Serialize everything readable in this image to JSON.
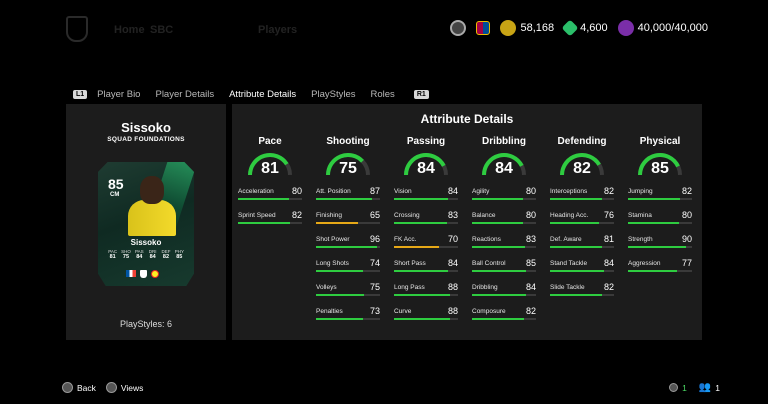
{
  "top": {
    "nav_faded": [
      "Home",
      "SBC",
      "Players"
    ],
    "currencies": [
      {
        "name": "coins",
        "value": "58,168",
        "color": "#c8a415"
      },
      {
        "name": "points",
        "value": "4,600",
        "color": "#2bbf6a"
      },
      {
        "name": "sp",
        "value": "40,000/40,000",
        "color": "#7a2ea8"
      }
    ]
  },
  "tabs": {
    "left_button": "L1",
    "right_button": "R1",
    "items": [
      "Player Bio",
      "Player Details",
      "Attribute Details",
      "PlayStyles",
      "Roles"
    ],
    "active_index": 2
  },
  "player": {
    "name": "Sissoko",
    "subtitle": "SQUAD FOUNDATIONS",
    "card": {
      "ovr": "85",
      "position": "CM",
      "name": "Sissoko",
      "stat_labels": [
        "PAC",
        "SHO",
        "PAS",
        "DRI",
        "DEF",
        "PHY"
      ],
      "stat_values": [
        "81",
        "75",
        "84",
        "84",
        "82",
        "85"
      ]
    },
    "playstyles": "PlayStyles: 6"
  },
  "panel_title": "Attribute Details",
  "categories": [
    {
      "name": "Pace",
      "value": 81,
      "attrs": [
        {
          "name": "Acceleration",
          "value": 80,
          "color": "#2ecc40"
        },
        {
          "name": "Sprint Speed",
          "value": 82,
          "color": "#2ecc40"
        }
      ]
    },
    {
      "name": "Shooting",
      "value": 75,
      "attrs": [
        {
          "name": "Att. Position",
          "value": 87,
          "color": "#2ecc40"
        },
        {
          "name": "Finishing",
          "value": 65,
          "color": "#e6a817"
        },
        {
          "name": "Shot Power",
          "value": 96,
          "color": "#2ecc40"
        },
        {
          "name": "Long Shots",
          "value": 74,
          "color": "#2ecc40"
        },
        {
          "name": "Volleys",
          "value": 75,
          "color": "#2ecc40"
        },
        {
          "name": "Penalties",
          "value": 73,
          "color": "#2ecc40"
        }
      ]
    },
    {
      "name": "Passing",
      "value": 84,
      "attrs": [
        {
          "name": "Vision",
          "value": 84,
          "color": "#2ecc40"
        },
        {
          "name": "Crossing",
          "value": 83,
          "color": "#2ecc40"
        },
        {
          "name": "FK Acc.",
          "value": 70,
          "color": "#e6a817"
        },
        {
          "name": "Short Pass",
          "value": 84,
          "color": "#2ecc40"
        },
        {
          "name": "Long Pass",
          "value": 88,
          "color": "#2ecc40"
        },
        {
          "name": "Curve",
          "value": 88,
          "color": "#2ecc40"
        }
      ]
    },
    {
      "name": "Dribbling",
      "value": 84,
      "attrs": [
        {
          "name": "Agility",
          "value": 80,
          "color": "#2ecc40"
        },
        {
          "name": "Balance",
          "value": 80,
          "color": "#2ecc40"
        },
        {
          "name": "Reactions",
          "value": 83,
          "color": "#2ecc40"
        },
        {
          "name": "Ball Control",
          "value": 85,
          "color": "#2ecc40"
        },
        {
          "name": "Dribbling",
          "value": 84,
          "color": "#2ecc40"
        },
        {
          "name": "Composure",
          "value": 82,
          "color": "#2ecc40"
        }
      ]
    },
    {
      "name": "Defending",
      "value": 82,
      "attrs": [
        {
          "name": "Interceptions",
          "value": 82,
          "color": "#2ecc40"
        },
        {
          "name": "Heading Acc.",
          "value": 76,
          "color": "#2ecc40"
        },
        {
          "name": "Def. Aware",
          "value": 81,
          "color": "#2ecc40"
        },
        {
          "name": "Stand Tackle",
          "value": 84,
          "color": "#2ecc40"
        },
        {
          "name": "Slide Tackle",
          "value": 82,
          "color": "#2ecc40"
        }
      ]
    },
    {
      "name": "Physical",
      "value": 85,
      "attrs": [
        {
          "name": "Jumping",
          "value": 82,
          "color": "#2ecc40"
        },
        {
          "name": "Stamina",
          "value": 80,
          "color": "#2ecc40"
        },
        {
          "name": "Strength",
          "value": 90,
          "color": "#2ecc40"
        },
        {
          "name": "Aggression",
          "value": 77,
          "color": "#2ecc40"
        }
      ]
    }
  ],
  "footer": {
    "back": "Back",
    "views": "Views",
    "count_a": "1",
    "count_b": "1"
  }
}
